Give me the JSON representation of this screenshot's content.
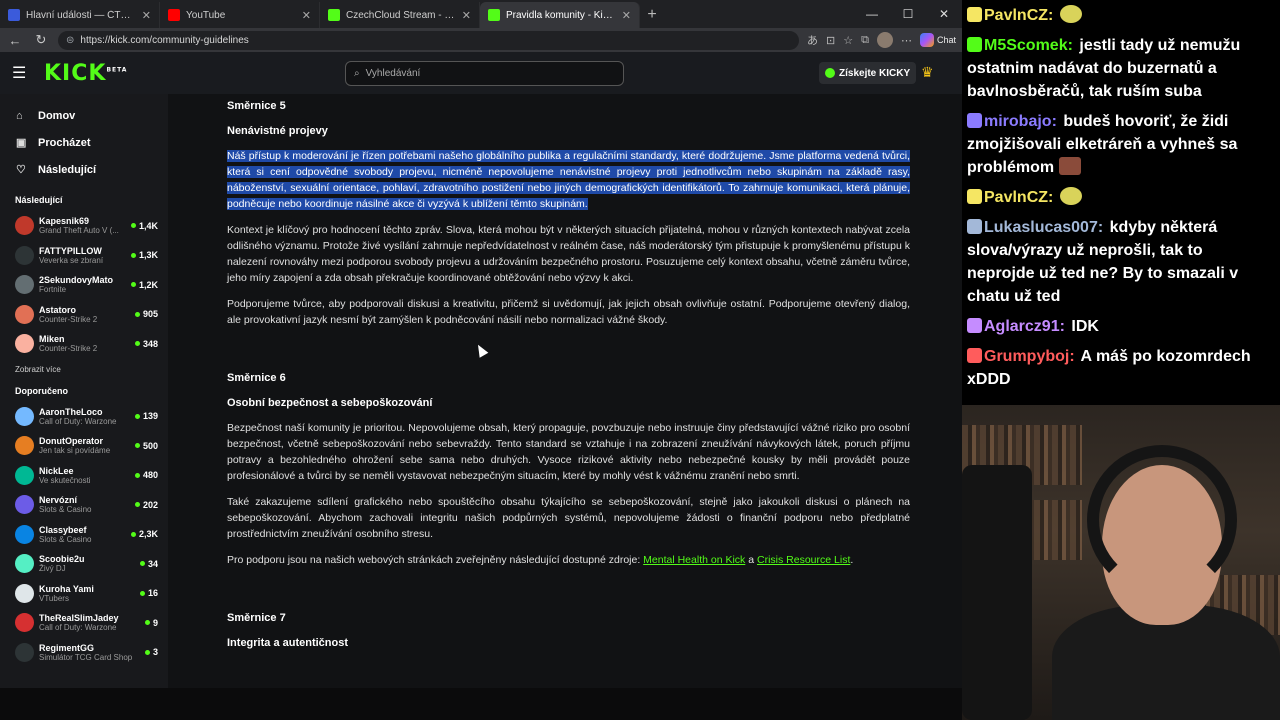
{
  "browser": {
    "tabs": [
      {
        "label": "Hlavní události — ČT24 — Česká te...",
        "color": "#3b5bdb",
        "active": false
      },
      {
        "label": "YouTube",
        "color": "#ff0000",
        "active": false
      },
      {
        "label": "CzechCloud Stream - Watch Live o...",
        "color": "#53fc18",
        "active": false
      },
      {
        "label": "Pravidla komunity - Kick Streamin...",
        "color": "#53fc18",
        "active": true
      }
    ],
    "url": "https://kick.com/community-guidelines",
    "chat_label": "Chat"
  },
  "kick": {
    "logo": "KICK",
    "logo_sup": "BETA",
    "search_placeholder": "Vyhledávání",
    "get_kicks": "Získejte KICKY",
    "nav": [
      {
        "label": "Domov",
        "icon": "home-icon"
      },
      {
        "label": "Procházet",
        "icon": "browse-icon"
      },
      {
        "label": "Následující",
        "icon": "heart-icon"
      }
    ],
    "following_title": "Následující",
    "following": [
      {
        "name": "Kapesnik69",
        "category": "Grand Theft Auto V (...",
        "viewers": "1,4K",
        "color": "#c0392b"
      },
      {
        "name": "FATTYPILLOW",
        "category": "Veverka se zbraní",
        "viewers": "1,3K",
        "color": "#2d3436"
      },
      {
        "name": "2SekundovyMato",
        "category": "Fortnite",
        "viewers": "1,2K",
        "color": "#636e72"
      },
      {
        "name": "Astatoro",
        "category": "Counter-Strike 2",
        "viewers": "905",
        "color": "#e17055"
      },
      {
        "name": "Miken",
        "category": "Counter-Strike 2",
        "viewers": "348",
        "color": "#fab1a0"
      }
    ],
    "show_more": "Zobrazit více",
    "recommended_title": "Doporučeno",
    "recommended": [
      {
        "name": "AaronTheLoco",
        "category": "Call of Duty: Warzone",
        "viewers": "139",
        "color": "#74b9ff"
      },
      {
        "name": "DonutOperator",
        "category": "Jen tak si povídáme",
        "viewers": "500",
        "color": "#e67e22"
      },
      {
        "name": "NickLee",
        "category": "Ve skutečnosti",
        "viewers": "480",
        "color": "#00b894"
      },
      {
        "name": "Nervózní",
        "category": "Slots & Casino",
        "viewers": "202",
        "color": "#6c5ce7"
      },
      {
        "name": "Classybeef",
        "category": "Slots & Casino",
        "viewers": "2,3K",
        "color": "#0984e3"
      },
      {
        "name": "Scoobie2u",
        "category": "Živý DJ",
        "viewers": "34",
        "color": "#55efc4"
      },
      {
        "name": "Kuroha Yami",
        "category": "VTubers",
        "viewers": "16",
        "color": "#dfe6e9"
      },
      {
        "name": "TheRealSlimJadey",
        "category": "Call of Duty: Warzone",
        "viewers": "9",
        "color": "#d63031"
      },
      {
        "name": "RegimentGG",
        "category": "Simulátor TCG Card Shop",
        "viewers": "3",
        "color": "#2d3436"
      }
    ]
  },
  "guidelines": {
    "s5_title": "Směrnice 5",
    "s5_sub": "Nenávistné projevy",
    "s5_p1": "Náš přístup k moderování je řízen potřebami našeho globálního publika a regulačními standardy, které dodržujeme. Jsme platforma vedená tvůrci, která si cení odpovědné svobody projevu, nicméně nepovolujeme nenávistné projevy proti jednotlivcům nebo skupinám na základě rasy, náboženství, sexuální orientace, pohlaví, zdravotního postižení nebo jiných demografických identifikátorů. To zahrnuje komunikaci, která plánuje, podněcuje nebo koordinuje násilné akce či vyzývá k ublížení těmto skupinám.",
    "s5_p2": "Kontext je klíčový pro hodnocení těchto zpráv. Slova, která mohou být v některých situacích přijatelná, mohou v různých kontextech nabývat zcela odlišného významu. Protože živé vysílání zahrnuje nepředvídatelnost v reálném čase, náš moderátorský tým přistupuje k promyšlenému přístupu k nalezení rovnováhy mezi podporou svobody projevu a udržováním bezpečného prostoru. Posuzujeme celý kontext obsahu, včetně záměru tvůrce, jeho míry zapojení a zda obsah překračuje koordinované obtěžování nebo výzvy k akci.",
    "s5_p3": "Podporujeme tvůrce, aby podporovali diskusi a kreativitu, přičemž si uvědomují, jak jejich obsah ovlivňuje ostatní. Podporujeme otevřený dialog, ale provokativní jazyk nesmí být zamýšlen k podněcování násilí nebo normalizaci vážné škody.",
    "s6_title": "Směrnice 6",
    "s6_sub": "Osobní bezpečnost a sebepoškozování",
    "s6_p1": "Bezpečnost naší komunity je prioritou. Nepovolujeme obsah, který propaguje, povzbuzuje nebo instruuje činy představující vážné riziko pro osobní bezpečnost, včetně sebepoškozování nebo sebevraždy. Tento standard se vztahuje i na zobrazení zneužívání návykových látek, poruch příjmu potravy a bezohledného ohrožení sebe sama nebo druhých. Vysoce rizikové aktivity nebo nebezpečné kousky by měli provádět pouze profesionálové a tvůrci by se neměli vystavovat nebezpečným situacím, které by mohly vést k vážnému zranění nebo smrti.",
    "s6_p2": "Také zakazujeme sdílení grafického nebo spouštěcího obsahu týkajícího se sebepoškozování, stejně jako jakoukoli diskusi o plánech na sebepoškozování. Abychom zachovali integritu našich podpůrných systémů, nepovolujeme žádosti o finanční podporu nebo předplatné prostřednictvím zneužívání osobního stresu.",
    "s6_p3_pre": "Pro podporu jsou na našich webových stránkách zveřejněny následující dostupné zdroje: ",
    "s6_link1": "Mental Health on Kick",
    "s6_and": " a ",
    "s6_link2": "Crisis Resource List",
    "s6_end": ".",
    "s7_title": "Směrnice 7",
    "s7_sub": "Integrita a autentičnost"
  },
  "chat": [
    {
      "user": "PavlnCZ:",
      "user_color": "#f5e663",
      "text": "",
      "emote": "pepe"
    },
    {
      "user": "M5Scomek:",
      "user_color": "#53fc18",
      "text": "jestli tady už nemužu ostatnim nadávat do buzernatů a bavlnosběračů, tak ruším suba"
    },
    {
      "user": "mirobajo:",
      "user_color": "#8b7bff",
      "text": "budeš hovoriť, že židi zmojžišovali elketráreň a vyhneš sa problémom",
      "emote": "pic"
    },
    {
      "user": "PavlnCZ:",
      "user_color": "#f5e663",
      "text": "",
      "emote": "pepe"
    },
    {
      "user": "Lukaslucas007:",
      "user_color": "#a3b8d8",
      "text": "kdyby některá slova/výrazy už neprošli, tak to neprojde už ted ne? By to smazali v chatu už ted"
    },
    {
      "user": "Aglarcz91:",
      "user_color": "#c58cff",
      "text": "IDK"
    },
    {
      "user": "Grumpyboj:",
      "user_color": "#ff5c5c",
      "text": "A máš po kozomrdech xDDD"
    }
  ]
}
